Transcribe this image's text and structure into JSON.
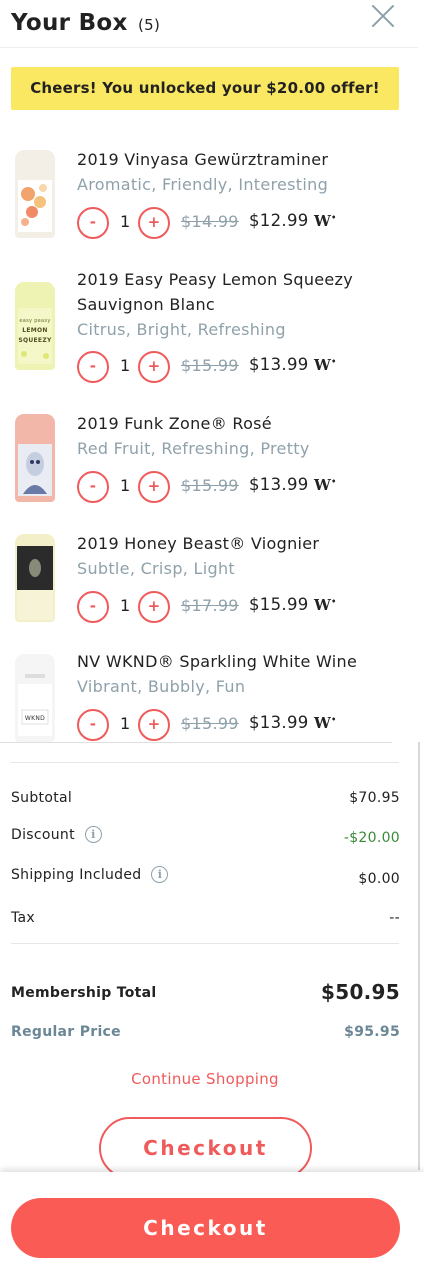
{
  "header": {
    "title": "Your Box",
    "count": "(5)",
    "close_icon": "close-icon"
  },
  "banner": {
    "text": "Cheers! You unlocked your $20.00 offer!",
    "background": "#fbe862"
  },
  "items": [
    {
      "name_line1": "2019 Vinyasa Gewürztraminer",
      "name_line2": "",
      "tags": "Aromatic, Friendly, Interesting",
      "qty": "1",
      "old_price": "$14.99",
      "price": "$12.99"
    },
    {
      "name_line1": "2019 Easy Peasy Lemon Squeezy",
      "name_line2": "Sauvignon Blanc",
      "tags": "Citrus, Bright, Refreshing",
      "qty": "1",
      "old_price": "$15.99",
      "price": "$13.99"
    },
    {
      "name_line1": "2019 Funk Zone® Rosé",
      "name_line2": "",
      "tags": "Red Fruit, Refreshing, Pretty",
      "qty": "1",
      "old_price": "$15.99",
      "price": "$13.99"
    },
    {
      "name_line1": "2019 Honey Beast® Viognier",
      "name_line2": "",
      "tags": "Subtle, Crisp, Light",
      "qty": "1",
      "old_price": "$17.99",
      "price": "$15.99"
    },
    {
      "name_line1": "NV WKND® Sparkling White Wine",
      "name_line2": "",
      "tags": "Vibrant, Bubbly, Fun",
      "qty": "1",
      "old_price": "$15.99",
      "price": "$13.99"
    }
  ],
  "controls": {
    "minus": "-",
    "plus": "+",
    "member_badge": "W"
  },
  "summary": {
    "subtotal_label": "Subtotal",
    "subtotal_value": "$70.95",
    "discount_label": "Discount",
    "discount_value": "-$20.00",
    "shipping_label": "Shipping Included",
    "shipping_value": "$0.00",
    "tax_label": "Tax",
    "tax_value": "--",
    "membership_label": "Membership Total",
    "membership_value": "$50.95",
    "regular_label": "Regular Price",
    "regular_value": "$95.95",
    "info_icon": "i"
  },
  "actions": {
    "continue": "Continue Shopping",
    "checkout": "Checkout"
  },
  "colors": {
    "accent": "#ef5b5b",
    "checkout_fill": "#fa5b55",
    "muted": "#8fa1ab",
    "discount": "#3a8a3a"
  }
}
